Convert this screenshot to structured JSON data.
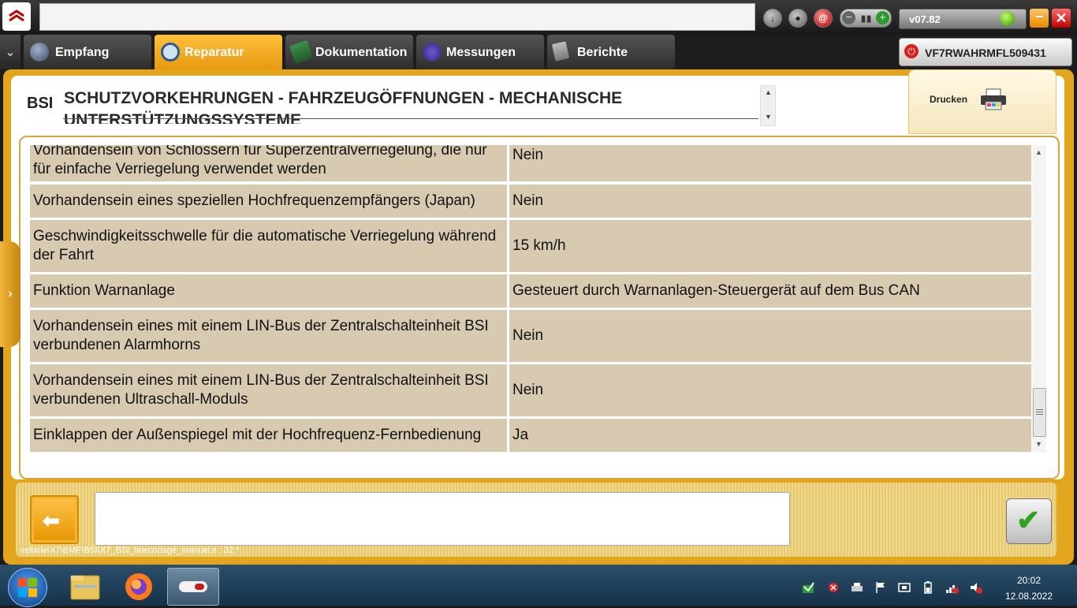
{
  "window": {
    "version": "v07.82",
    "vin": "VF7RWAHRMFL509431"
  },
  "tabs": [
    {
      "label": "Empfang",
      "icon": "globe-icon",
      "active": false
    },
    {
      "label": "Reparatur",
      "icon": "magnifier-icon",
      "active": true
    },
    {
      "label": "Dokumentation",
      "icon": "book-icon",
      "active": false
    },
    {
      "label": "Messungen",
      "icon": "waveform-icon",
      "active": false
    },
    {
      "label": "Berichte",
      "icon": "document-icon",
      "active": false
    }
  ],
  "header": {
    "ecu": "BSI",
    "title": "SCHUTZVORKEHRUNGEN - FAHRZEUGÖFFNUNGEN - MECHANISCHE UNTERSTÜTZUNGSSYSTEME",
    "print_label": "Drucken"
  },
  "rows": [
    {
      "param": "Vorhandensein von Schlössern für Superzentralverriegelung, die nur für einfache Verriegelung verwendet werden",
      "value": "Nein"
    },
    {
      "param": "Vorhandensein eines speziellen Hochfrequenzempfängers (Japan)",
      "value": "Nein"
    },
    {
      "param": "Geschwindigkeitsschwelle für die automatische Verriegelung während der Fahrt",
      "value": "15 km/h"
    },
    {
      "param": "Funktion Warnanlage",
      "value": "Gesteuert durch Warnanlagen-Steuergerät auf dem Bus CAN"
    },
    {
      "param": "Vorhandensein eines mit einem LIN-Bus der Zentralschalteinheit BSI verbundenen Alarmhorns",
      "value": "Nein"
    },
    {
      "param": "Vorhandensein eines mit einem LIN-Bus der Zentralschalteinheit BSI verbundenen Ultraschall-Moduls",
      "value": "Nein"
    },
    {
      "param": "Einklappen der Außenspiegel mit der Hochfrequenz-Fernbedienung",
      "value": "Ja"
    }
  ],
  "footer": {
    "message": "",
    "path": "vehicle\\X7\\BMF\\BSI\\X7_BSI_telecodage_manuel.s : 32 *"
  },
  "taskbar": {
    "time": "20:02",
    "date": "12.08.2022"
  },
  "colors": {
    "accent": "#e4a51e",
    "row_bg": "#d8cab0",
    "close": "#c00000",
    "ok": "#2fa31f"
  }
}
